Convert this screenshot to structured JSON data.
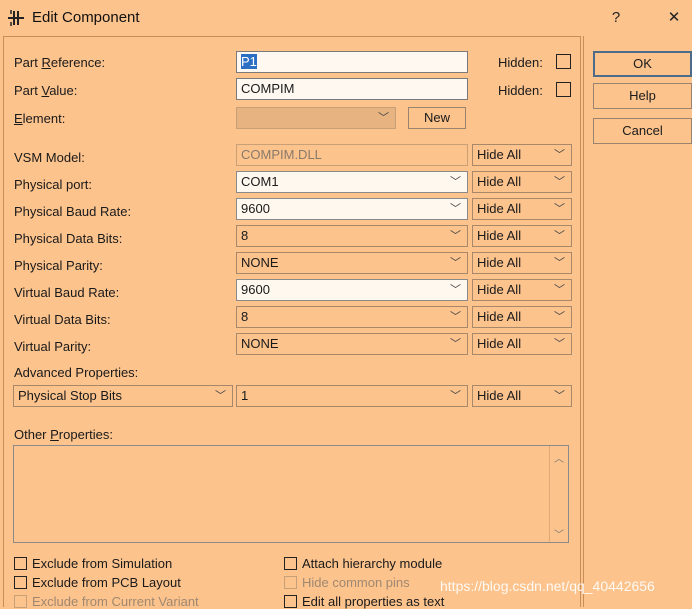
{
  "window": {
    "title": "Edit Component",
    "help_glyph": "?",
    "close_glyph": "✕"
  },
  "part_reference": {
    "label_pre": "Part ",
    "label_u": "R",
    "label_post": "eference:",
    "value": "P1",
    "hidden_label": "Hidden:"
  },
  "part_value": {
    "label_pre": "Part ",
    "label_u": "V",
    "label_post": "alue:",
    "value": "COMPIM",
    "hidden_label": "Hidden:"
  },
  "element": {
    "label_u": "E",
    "label_post": "lement:",
    "value": "",
    "new_button": "New"
  },
  "properties": [
    {
      "label": "VSM Model:",
      "value": "COMPIM.DLL",
      "kind": "disabled",
      "hide": "Hide All"
    },
    {
      "label": "Physical port:",
      "value": "COM1",
      "kind": "active",
      "hide": "Hide All"
    },
    {
      "label": "Physical Baud Rate:",
      "value": "9600",
      "kind": "active",
      "hide": "Hide All"
    },
    {
      "label": "Physical Data Bits:",
      "value": "8",
      "kind": "normal",
      "hide": "Hide All"
    },
    {
      "label": "Physical Parity:",
      "value": "NONE",
      "kind": "normal",
      "hide": "Hide All"
    },
    {
      "label": "Virtual Baud Rate:",
      "value": "9600",
      "kind": "active",
      "hide": "Hide All"
    },
    {
      "label": "Virtual Data Bits:",
      "value": "8",
      "kind": "normal",
      "hide": "Hide All"
    },
    {
      "label": "Virtual Parity:",
      "value": "NONE",
      "kind": "normal",
      "hide": "Hide All"
    }
  ],
  "advanced": {
    "label": "Advanced Properties:",
    "property": "Physical Stop Bits",
    "value": "1",
    "hide": "Hide All"
  },
  "other_properties": {
    "label_pre": "Other ",
    "label_u": "P",
    "label_post": "roperties:",
    "text": ""
  },
  "checkboxes": {
    "exclude_simulation": "Exclude from Simulation",
    "exclude_pcb": "Exclude from PCB Layout",
    "exclude_variant": "Exclude from Current Variant",
    "attach_hierarchy": "Attach hierarchy module",
    "hide_common_pins": "Hide common pins",
    "edit_all_as_text": "Edit all properties as text"
  },
  "buttons": {
    "ok": "OK",
    "help": "Help",
    "cancel": "Cancel"
  },
  "watermark": "https://blog.csdn.net/qq_40442656"
}
